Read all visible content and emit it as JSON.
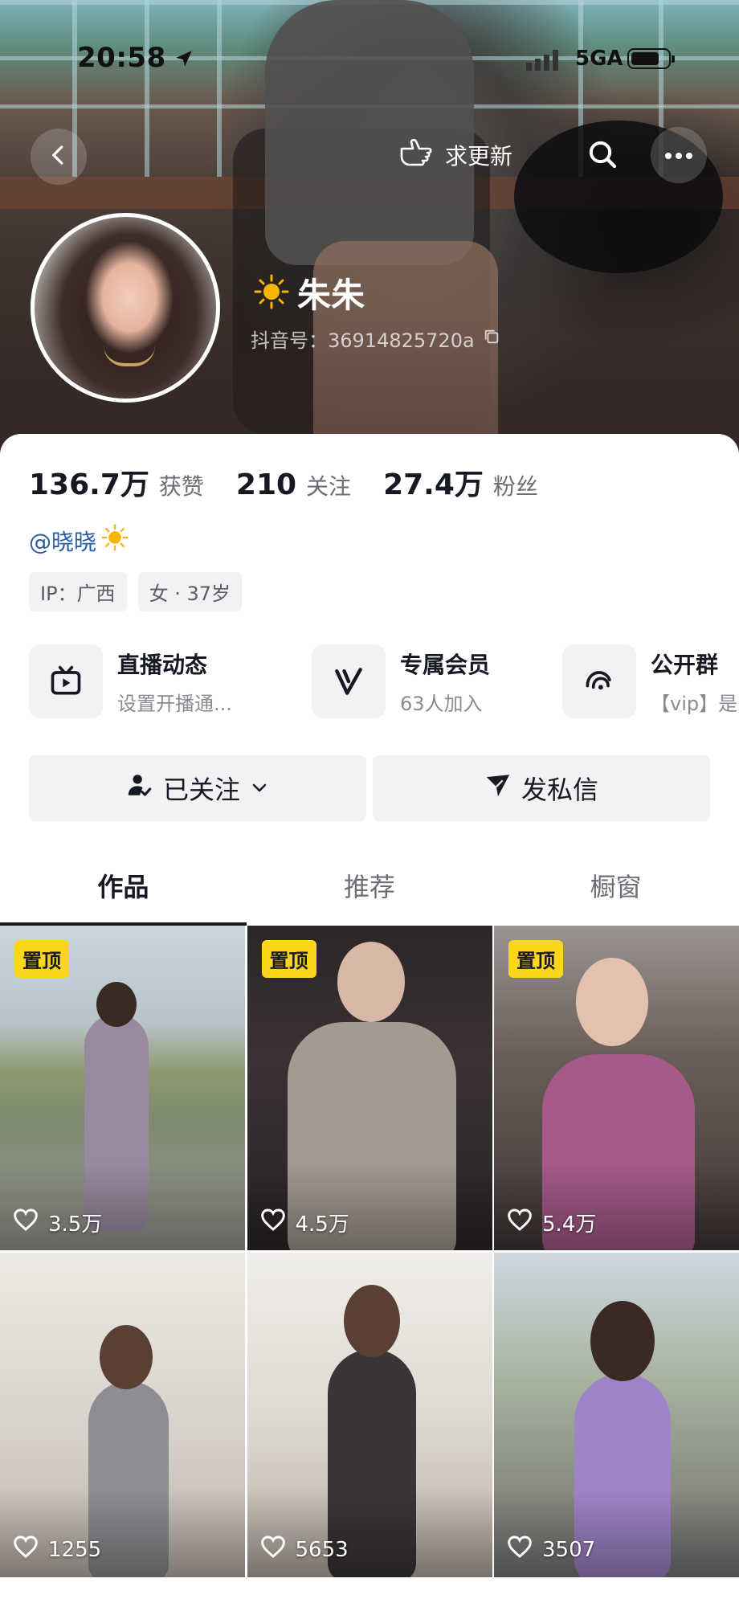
{
  "status_bar": {
    "time": "20:58",
    "network": "5GA",
    "icons": [
      "location-arrow-icon",
      "signal-icon",
      "battery-icon"
    ]
  },
  "top_bar": {
    "update_label": "求更新",
    "icons": [
      "back-arrow-icon",
      "hand-point-icon",
      "search-icon",
      "more-icon"
    ]
  },
  "profile": {
    "name": "朱朱",
    "name_emoji": "☀️",
    "douyin_id": "抖音号：36914825720a"
  },
  "stats": [
    {
      "value": "136.7万",
      "label": "获赞"
    },
    {
      "value": "210",
      "label": "关注"
    },
    {
      "value": "27.4万",
      "label": "粉丝"
    }
  ],
  "bio": {
    "mention": "@晓晓",
    "emoji": "☀️"
  },
  "tags": [
    "IP：广西",
    "女 · 37岁"
  ],
  "features": [
    {
      "title": "直播动态",
      "subtitle": "设置开播通...",
      "icon": "live-tv-icon"
    },
    {
      "title": "专属会员",
      "subtitle": "63人加入",
      "icon": "vip-v-icon"
    },
    {
      "title": "公开群",
      "subtitle": "【vip】是",
      "icon": "group-chat-icon"
    }
  ],
  "actions": {
    "follow_label": "已关注",
    "message_label": "发私信"
  },
  "tabs": [
    "作品",
    "推荐",
    "橱窗"
  ],
  "videos": [
    {
      "pinned": true,
      "pin_label": "置顶",
      "likes": "3.5万"
    },
    {
      "pinned": true,
      "pin_label": "置顶",
      "likes": "4.5万"
    },
    {
      "pinned": true,
      "pin_label": "置顶",
      "likes": "5.4万"
    },
    {
      "pinned": false,
      "likes": "1255"
    },
    {
      "pinned": false,
      "likes": "5653"
    },
    {
      "pinned": false,
      "likes": "3507"
    }
  ],
  "colors": {
    "pin_badge": "#fbd61d",
    "mention_link": "#2c5aa0",
    "chip_bg": "#f2f2f4"
  }
}
